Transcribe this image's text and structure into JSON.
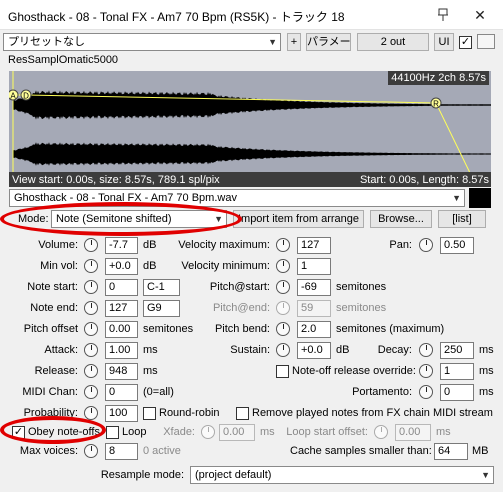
{
  "window": {
    "title": "Ghosthack - 08 - Tonal FX - Am7 70 Bpm (RS5K) - トラック 18",
    "pin_icon": "pin-icon",
    "close_icon": "close-icon"
  },
  "toolbar": {
    "preset_value": "プリセットなし",
    "add_label": "+",
    "params_label": "パラメータ",
    "io_label": "2 out",
    "ui_label": "UI"
  },
  "plugin": {
    "name": "ResSamplOmatic5000"
  },
  "waveform": {
    "format_text": "44100Hz 2ch 8.57s",
    "view_text": "View start: 0.00s, size: 8.57s, 789.1 spl/pix",
    "start_text": "Start: 0.00s, Length: 8.57s",
    "marker_a": "A",
    "marker_d": "D",
    "marker_r": "R",
    "wave_color": "#000000",
    "env_color": "#ffff5a"
  },
  "file": {
    "value": "Ghosthack - 08 - Tonal FX - Am7 70 Bpm.wav"
  },
  "mode": {
    "label": "Mode:",
    "value": "Note (Semitone shifted)",
    "import_label": "Import item from arrange",
    "browse_label": "Browse...",
    "list_label": "[list]"
  },
  "params": {
    "volume": {
      "label": "Volume:",
      "value": "-7.7",
      "unit": "dB"
    },
    "velmax": {
      "label": "Velocity maximum:",
      "value": "127"
    },
    "pan": {
      "label": "Pan:",
      "value": "0.50"
    },
    "minvol": {
      "label": "Min vol:",
      "value": "+0.0",
      "unit": "dB"
    },
    "velmin": {
      "label": "Velocity minimum:",
      "value": "1"
    },
    "notestart": {
      "label": "Note start:",
      "value": "0",
      "note": "C-1"
    },
    "pitchstart": {
      "label": "Pitch@start:",
      "value": "-69",
      "unit": "semitones"
    },
    "noteend": {
      "label": "Note end:",
      "value": "127",
      "note": "G9"
    },
    "pitchend": {
      "label": "Pitch@end:",
      "value": "59",
      "unit": "semitones"
    },
    "pitchoffset": {
      "label": "Pitch offset",
      "value": "0.00",
      "unit": "semitones"
    },
    "pitchbend": {
      "label": "Pitch bend:",
      "value": "2.0",
      "unit": "semitones (maximum)"
    },
    "attack": {
      "label": "Attack:",
      "value": "1.00",
      "unit": "ms"
    },
    "sustain": {
      "label": "Sustain:",
      "value": "+0.0",
      "unit": "dB"
    },
    "decay": {
      "label": "Decay:",
      "value": "250",
      "unit": "ms"
    },
    "release": {
      "label": "Release:",
      "value": "948",
      "unit": "ms"
    },
    "noteoff_override": {
      "label": "Note-off release override:",
      "value": "1",
      "unit": "ms"
    },
    "midichan": {
      "label": "MIDI Chan:",
      "value": "0",
      "unit": "(0=all)"
    },
    "portamento": {
      "label": "Portamento:",
      "value": "0",
      "unit": "ms"
    },
    "probability": {
      "label": "Probability:",
      "value": "100"
    },
    "roundrobin": {
      "label": "Round-robin"
    },
    "removeplayed": {
      "label": "Remove played notes from FX chain MIDI stream"
    },
    "obeynoteoff": {
      "label": "Obey note-offs",
      "checked": "✓"
    },
    "loop": {
      "label": "Loop"
    },
    "xfade": {
      "label": "Xfade:",
      "value": "0.00",
      "unit": "ms"
    },
    "loopstartoffset": {
      "label": "Loop start offset:",
      "value": "0.00",
      "unit": "ms"
    },
    "maxvoices": {
      "label": "Max voices:",
      "value": "8",
      "unit": "0 active"
    },
    "cache": {
      "label": "Cache samples smaller than:",
      "value": "64",
      "unit": "MB"
    },
    "resample": {
      "label": "Resample mode:",
      "value": "(project default)"
    }
  },
  "annotation_color": "#e00000"
}
